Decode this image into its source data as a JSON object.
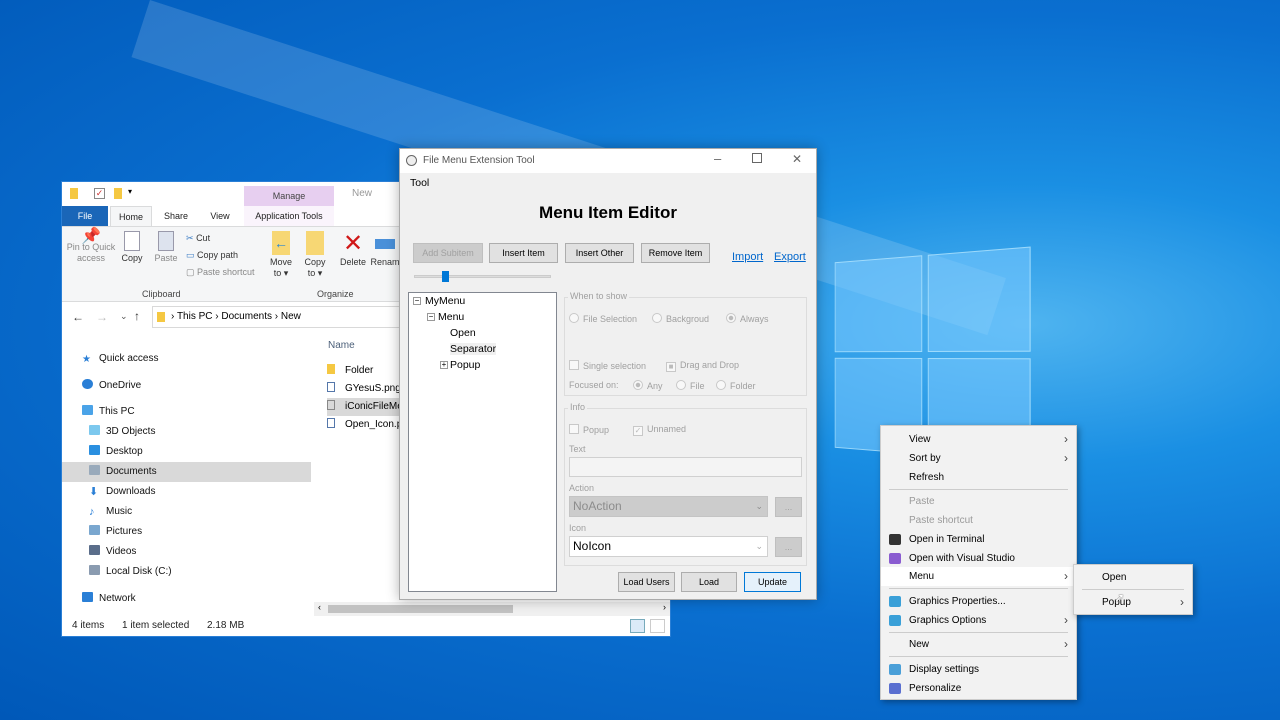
{
  "explorer": {
    "qa_toolbar": "quick-access-toolbar",
    "contextual_group": "Manage",
    "window_title": "New",
    "tabs": [
      "File",
      "Home",
      "Share",
      "View",
      "Application Tools"
    ],
    "ribbon": {
      "pin": "Pin to Quick access",
      "copy": "Copy",
      "paste": "Paste",
      "cut": "Cut",
      "copy_path": "Copy path",
      "paste_shortcut": "Paste shortcut",
      "move_to": "Move to",
      "copy_to": "Copy to",
      "delete": "Delete",
      "rename": "Renam",
      "clipboard_group": "Clipboard",
      "organize_group": "Organize"
    },
    "breadcrumb": [
      "This PC",
      "Documents",
      "New"
    ],
    "nav": [
      "Quick access",
      "OneDrive",
      "This PC",
      "3D Objects",
      "Desktop",
      "Documents",
      "Downloads",
      "Music",
      "Pictures",
      "Videos",
      "Local Disk (C:)",
      "Network"
    ],
    "column_name": "Name",
    "files": [
      "Folder",
      "GYesuS.png",
      "iConicFileMe",
      "Open_Icon.p"
    ],
    "status": {
      "count": "4 items",
      "selected": "1 item selected",
      "size": "2.18 MB"
    }
  },
  "tool": {
    "title": "File Menu Extension Tool",
    "menu": "Tool",
    "heading": "Menu Item Editor",
    "buttons": {
      "add_subitem": "Add Subitem",
      "insert_item": "Insert Item",
      "insert_other": "Insert Other",
      "remove_item": "Remove Item",
      "load_users": "Load Users",
      "load": "Load",
      "update": "Update",
      "browse": "..."
    },
    "links": {
      "import": "Import",
      "export": "Export"
    },
    "slider_value": 0.22,
    "tree": [
      "MyMenu",
      "Menu",
      "Open",
      "Separator",
      "Popup"
    ],
    "when_to_show": {
      "label": "When to show",
      "file_selection": "File Selection",
      "background": "Backgroud",
      "always": "Always",
      "single_selection": "Single selection",
      "drag_drop": "Drag and Drop",
      "focused_on": "Focused on:",
      "any": "Any",
      "file": "File",
      "folder": "Folder"
    },
    "info": {
      "label": "Info",
      "popup": "Popup",
      "unnamed": "Unnamed",
      "text_label": "Text",
      "text_value": "",
      "action_label": "Action",
      "action_value": "NoAction",
      "icon_label": "Icon",
      "icon_value": "NoIcon"
    }
  },
  "context_menu": {
    "items": [
      "View",
      "Sort by",
      "Refresh",
      "Paste",
      "Paste shortcut",
      "Open in Terminal",
      "Open with Visual Studio",
      "Menu",
      "Graphics Properties...",
      "Graphics Options",
      "New",
      "Display settings",
      "Personalize"
    ],
    "submenu": [
      "Open",
      "Popup"
    ]
  }
}
